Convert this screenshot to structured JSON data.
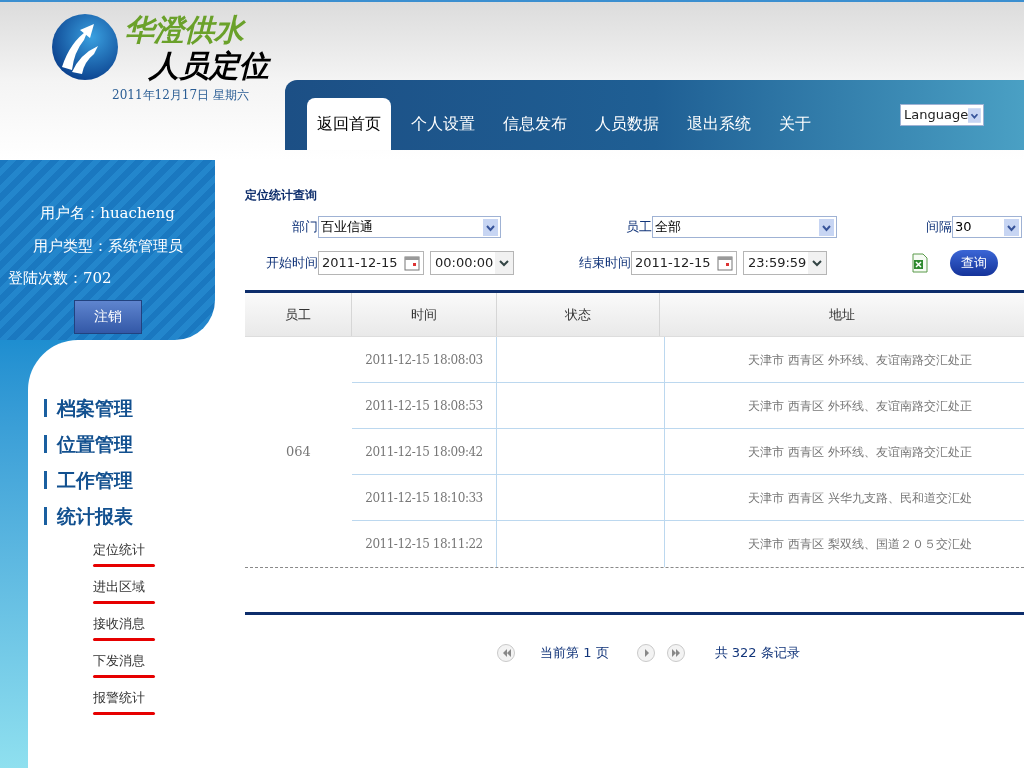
{
  "logo": {
    "brand": "华澄供水",
    "product": "人员定位",
    "date": "2011年12月17日 星期六"
  },
  "nav": {
    "tabs": [
      {
        "label": "返回首页",
        "selected": true
      },
      {
        "label": "个人设置",
        "selected": false
      },
      {
        "label": "信息发布",
        "selected": false
      },
      {
        "label": "人员数据",
        "selected": false
      },
      {
        "label": "退出系统",
        "selected": false
      },
      {
        "label": "关于",
        "selected": false
      }
    ],
    "language": "Language"
  },
  "user": {
    "name_label": "用户名：",
    "name": "huacheng",
    "type_label": "用户类型：",
    "type": "系统管理员",
    "logins_label": "登陆次数：",
    "logins": "702",
    "logout": "注销"
  },
  "menu": [
    {
      "label": "档案管理"
    },
    {
      "label": "位置管理"
    },
    {
      "label": "工作管理"
    },
    {
      "label": "统计报表",
      "children": [
        {
          "label": "定位统计"
        },
        {
          "label": "进出区域"
        },
        {
          "label": "接收消息"
        },
        {
          "label": "下发消息"
        },
        {
          "label": "报警统计"
        }
      ]
    }
  ],
  "query": {
    "title": "定位统计查询",
    "department_label": "部门",
    "department": "百业信通",
    "employee_label": "员工",
    "employee": "全部",
    "interval_label": "间隔",
    "interval": "30",
    "start_label": "开始时间",
    "start_date": "2011-12-15",
    "start_time": "00:00:00",
    "end_label": "结束时间",
    "end_date": "2011-12-15",
    "end_time": "23:59:59",
    "submit": "查询"
  },
  "table": {
    "columns": [
      "员工",
      "时间",
      "状态",
      "地址"
    ],
    "employee": "064",
    "rows": [
      {
        "time": "2011-12-15 18:08:03",
        "address": "天津市 西青区 外环线、友谊南路交汇处正"
      },
      {
        "time": "2011-12-15 18:08:53",
        "address": "天津市 西青区 外环线、友谊南路交汇处正"
      },
      {
        "time": "2011-12-15 18:09:42",
        "address": "天津市 西青区 外环线、友谊南路交汇处正"
      },
      {
        "time": "2011-12-15 18:10:33",
        "address": "天津市 西青区 兴华九支路、民和道交汇处"
      },
      {
        "time": "2011-12-15 18:11:22",
        "address": "天津市 西青区 梨双线、国道２０５交汇处"
      }
    ]
  },
  "pagination": {
    "current": "当前第 1 页",
    "total": "共 322 条记录"
  }
}
